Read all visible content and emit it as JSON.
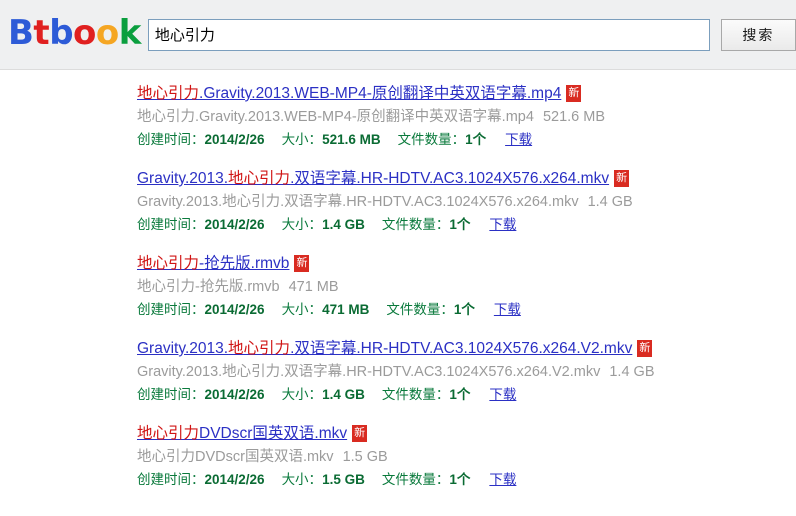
{
  "header": {
    "logo": {
      "letters": [
        {
          "char": "B",
          "color": "#2d5bd7"
        },
        {
          "char": "t",
          "color": "#e02020"
        },
        {
          "char": "b",
          "color": "#2d5bd7"
        },
        {
          "char": "o",
          "color": "#e02020"
        },
        {
          "char": "o",
          "color": "#f5a623"
        },
        {
          "char": "k",
          "color": "#0a9e3e"
        }
      ]
    },
    "search": {
      "value": "地心引力",
      "placeholder": "",
      "button_label": "搜索"
    }
  },
  "labels": {
    "created_label": "创建时间：",
    "size_label": "大小：",
    "count_label": "文件数量：",
    "download_label": "下载",
    "new_badge": "新"
  },
  "results": [
    {
      "title_parts": [
        {
          "text": "地心引力",
          "highlight": true
        },
        {
          "text": ".Gravity.2013.WEB-MP4-原创翻译中英双语字幕.mp4",
          "highlight": false
        }
      ],
      "description": "地心引力.Gravity.2013.WEB-MP4-原创翻译中英双语字幕.mp4",
      "desc_size": "521.6 MB",
      "created": "2014/2/26",
      "size": "521.6 MB",
      "count": "1个"
    },
    {
      "title_parts": [
        {
          "text": "Gravity.2013.",
          "highlight": false
        },
        {
          "text": "地心引力",
          "highlight": true
        },
        {
          "text": ".双语字幕.HR-HDTV.AC3.1024X576.x264.mkv",
          "highlight": false
        }
      ],
      "description": "Gravity.2013.地心引力.双语字幕.HR-HDTV.AC3.1024X576.x264.mkv",
      "desc_size": "1.4 GB",
      "created": "2014/2/26",
      "size": "1.4 GB",
      "count": "1个"
    },
    {
      "title_parts": [
        {
          "text": "地心引力",
          "highlight": true
        },
        {
          "text": "-抢先版.rmvb",
          "highlight": false
        }
      ],
      "description": "地心引力-抢先版.rmvb",
      "desc_size": "471 MB",
      "created": "2014/2/26",
      "size": "471 MB",
      "count": "1个"
    },
    {
      "title_parts": [
        {
          "text": "Gravity.2013.",
          "highlight": false
        },
        {
          "text": "地心引力",
          "highlight": true
        },
        {
          "text": ".双语字幕.HR-HDTV.AC3.1024X576.x264.V2.mkv",
          "highlight": false
        }
      ],
      "description": "Gravity.2013.地心引力.双语字幕.HR-HDTV.AC3.1024X576.x264.V2.mkv",
      "desc_size": "1.4 GB",
      "created": "2014/2/26",
      "size": "1.4 GB",
      "count": "1个"
    },
    {
      "title_parts": [
        {
          "text": "地心引力",
          "highlight": true
        },
        {
          "text": "DVDscr国英双语.mkv",
          "highlight": false
        }
      ],
      "description": "地心引力DVDscr国英双语.mkv",
      "desc_size": "1.5 GB",
      "created": "2014/2/26",
      "size": "1.5 GB",
      "count": "1个"
    }
  ]
}
